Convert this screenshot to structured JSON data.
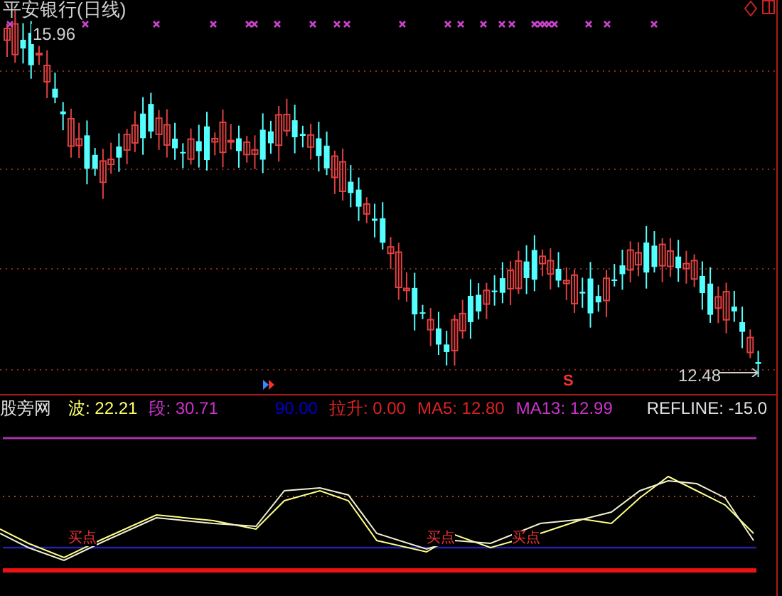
{
  "title": "平安银行(日线)",
  "price_high": "15.96",
  "price_low": "12.48",
  "sell_marker": "S",
  "legend": [
    {
      "label": "股旁网",
      "color": "#e0e0e0"
    },
    {
      "label": "波: 22.21",
      "color": "#ffff66"
    },
    {
      "label": "段: 30.71",
      "color": "#cc33cc"
    },
    {
      "label": "90.00",
      "color": "#0000cc"
    },
    {
      "label": "拉升: 0.00",
      "color": "#dd2222"
    },
    {
      "label": "MA5: 12.80",
      "color": "#dd2222"
    },
    {
      "label": "MA13: 12.99",
      "color": "#cc33cc"
    },
    {
      "label": "REFLINE: -15.0",
      "color": "#e0e0e0"
    }
  ],
  "signals": [
    "买点",
    "买点",
    "买点"
  ]
}
